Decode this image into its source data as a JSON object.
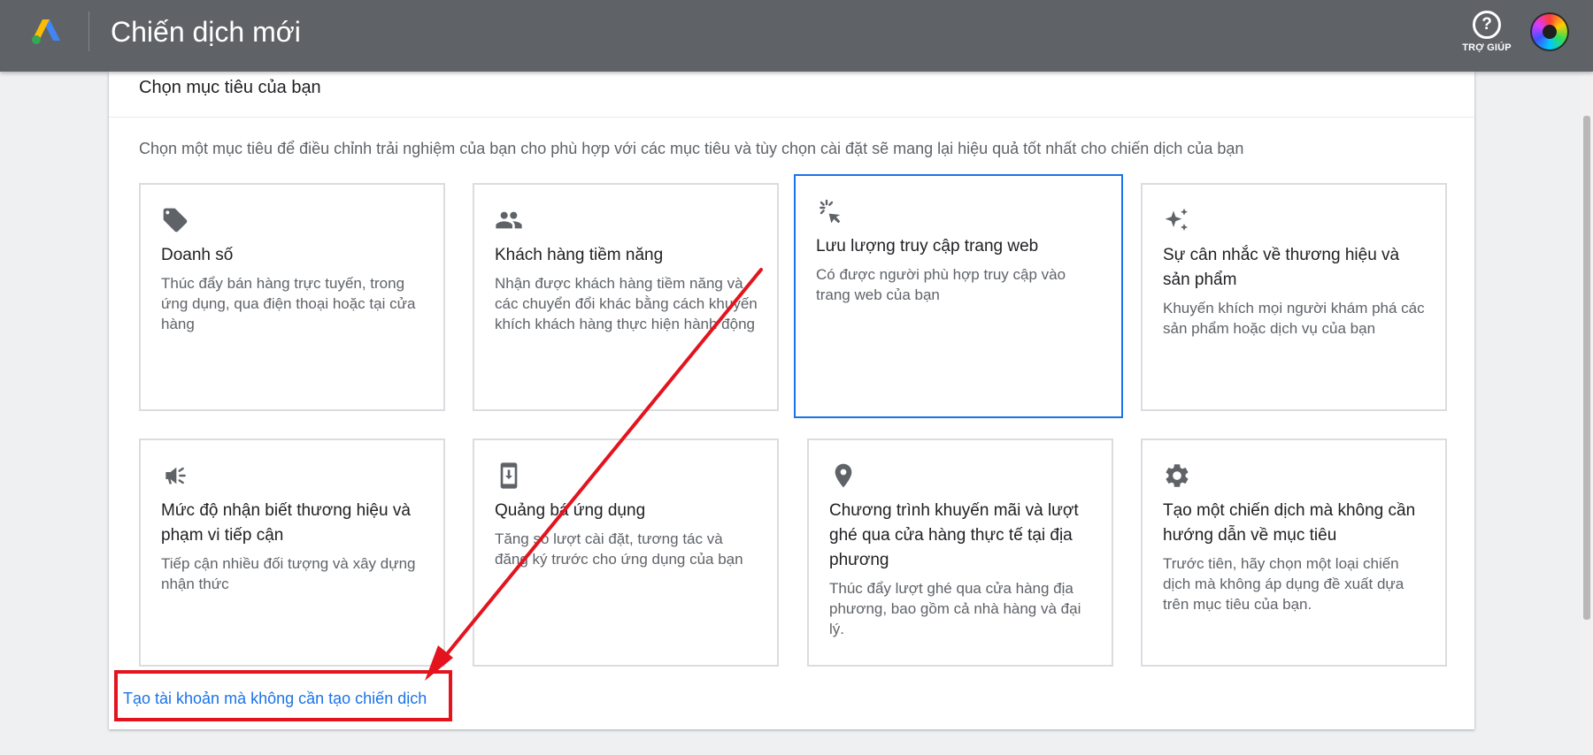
{
  "header": {
    "app_title": "Chiến dịch mới",
    "logo_icon": "google-ads-logo",
    "help_icon": "question-circle-icon",
    "help_label": "TRỢ GIÚP",
    "avatar_icon": "color-wheel-avatar"
  },
  "panel": {
    "heading": "Chọn mục tiêu của bạn",
    "description": "Chọn một mục tiêu để điều chỉnh trải nghiệm của bạn cho phù hợp với các mục tiêu và tùy chọn cài đặt sẽ mang lại hiệu quả tốt nhất cho chiến dịch của bạn",
    "goals": [
      {
        "icon": "tag-icon",
        "title": "Doanh số",
        "desc": "Thúc đẩy bán hàng trực tuyến, trong ứng dụng, qua điện thoại hoặc tại cửa hàng",
        "selected": false
      },
      {
        "icon": "people-icon",
        "title": "Khách hàng tiềm năng",
        "desc": "Nhận được khách hàng tiềm năng và các chuyển đổi khác bằng cách khuyến khích khách hàng thực hiện hành động",
        "selected": false
      },
      {
        "icon": "cursor-click-icon",
        "title": "Lưu lượng truy cập trang web",
        "desc": "Có được người phù hợp truy cập vào trang web của bạn",
        "selected": true
      },
      {
        "icon": "sparkle-icon",
        "title": "Sự cân nhắc về thương hiệu và sản phẩm",
        "desc": "Khuyến khích mọi người khám phá các sản phẩm hoặc dịch vụ của bạn",
        "selected": false
      },
      {
        "icon": "megaphone-icon",
        "title": "Mức độ nhận biết thương hiệu và phạm vi tiếp cận",
        "desc": "Tiếp cận nhiều đối tượng và xây dựng nhận thức",
        "selected": false
      },
      {
        "icon": "phone-download-icon",
        "title": "Quảng bá ứng dụng",
        "desc": "Tăng số lượt cài đặt, tương tác và đăng ký trước cho ứng dụng của bạn",
        "selected": false
      },
      {
        "icon": "location-pin-icon",
        "title": "Chương trình khuyến mãi và lượt ghé qua cửa hàng thực tế tại địa phương",
        "desc": "Thúc đẩy lượt ghé qua cửa hàng địa phương, bao gồm cả nhà hàng và đại lý.",
        "selected": false
      },
      {
        "icon": "gear-icon",
        "title": "Tạo một chiến dịch mà không cần hướng dẫn về mục tiêu",
        "desc": "Trước tiên, hãy chọn một loại chiến dịch mà không áp dụng đề xuất dựa trên mục tiêu của bạn.",
        "selected": false
      }
    ],
    "bottom_link": "Tạo tài khoản mà không cần tạo chiến dịch"
  },
  "annotation": {
    "color": "#e3141e"
  },
  "colors": {
    "header_bg": "#5f6368",
    "accent": "#1a73e8",
    "page_bg": "#eef0f2"
  }
}
